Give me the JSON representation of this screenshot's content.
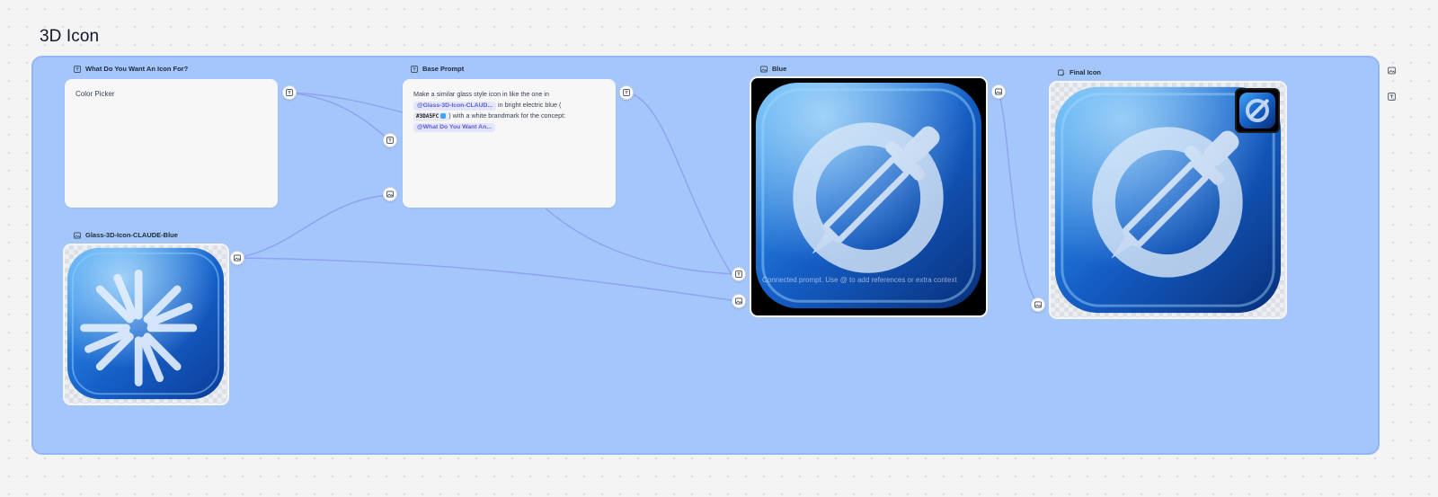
{
  "page": {
    "title": "3D Icon"
  },
  "nodes": {
    "what_for": {
      "title": "What Do You Want An Icon For?",
      "value": "Color Picker"
    },
    "base_prompt": {
      "title": "Base Prompt",
      "text_1": "Make a similar glass style icon in like the one in",
      "ref_image": "@Glass-3D-Icon-CLAUD...",
      "text_2": "in  bright electric blue (",
      "hex": "#3DA5FC",
      "hex_color": "#3DA5FC",
      "text_3": ") with a white brandmark for the concept:",
      "ref_text": "@What Do You Want An..."
    },
    "glass_icon": {
      "title": "Glass-3D-Icon-CLAUDE-Blue"
    },
    "blue": {
      "title": "Blue",
      "overlay_prompt": "Connected prompt. Use @ to add references or extra context"
    },
    "final": {
      "title": "Final Icon"
    }
  },
  "icons": {
    "text_node": "text-icon",
    "image_node": "image-icon"
  },
  "colors": {
    "group_bg": "#a4c6fb",
    "wire": "#8a9cf0",
    "accent": "#3DA5FC"
  }
}
